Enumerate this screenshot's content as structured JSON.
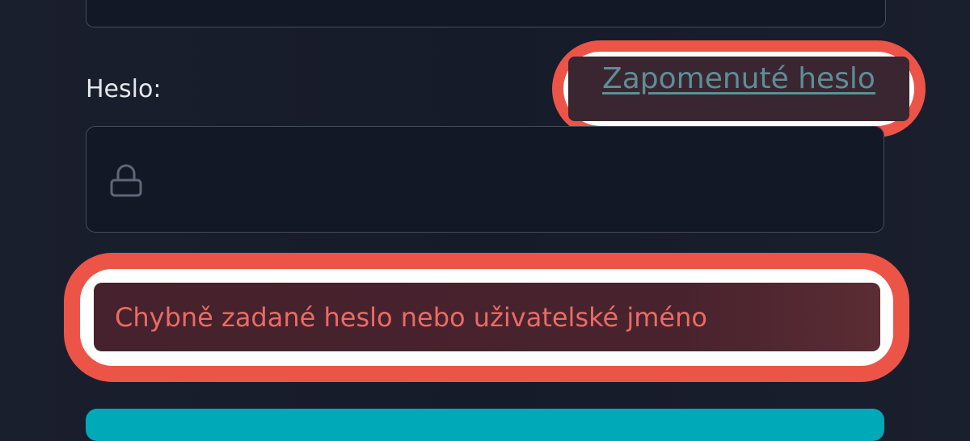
{
  "form": {
    "password_label": "Heslo:",
    "forgot_password_link": "Zapomenuté heslo",
    "password_value": "",
    "error_message": "Chybně zadané heslo nebo uživatelské jméno"
  },
  "icons": {
    "password_field_icon": "lock-icon"
  },
  "colors": {
    "background": "#161b29",
    "link": "#5d8e97",
    "error_text": "#ea6b64",
    "error_background": "#48232e",
    "highlight": "#ec5448",
    "primary_button": "#00a9b8"
  }
}
